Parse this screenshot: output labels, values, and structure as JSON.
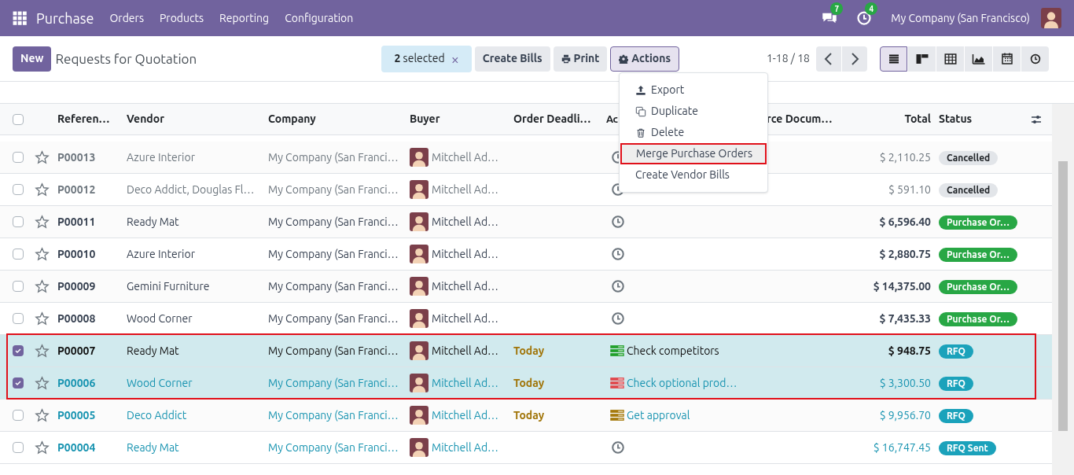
{
  "navbar": {
    "app": "Purchase",
    "menu": [
      "Orders",
      "Products",
      "Reporting",
      "Configuration"
    ],
    "messages_count": "7",
    "activities_count": "4",
    "company": "My Company (San Francisco)"
  },
  "control_panel": {
    "new_button": "New",
    "title": "Requests for Quotation",
    "selection": "**2** selected",
    "clear": "×",
    "buttons": [
      "Create Bills",
      "Print",
      "Actions"
    ],
    "pager": "1-18 / 18",
    "views": [
      {
        "kind": "list",
        "selected": true
      },
      {
        "kind": "kanban",
        "selected": false
      },
      {
        "kind": "pivot",
        "selected": false
      },
      {
        "kind": "graph",
        "selected": false
      },
      {
        "kind": "calendar",
        "selected": false
      },
      {
        "kind": "activity",
        "selected": false
      }
    ]
  },
  "actions_menu": [
    {
      "kind": "export",
      "label": "Export",
      "highlighted": false
    },
    {
      "kind": "duplicate",
      "label": "Duplicate",
      "highlighted": false
    },
    {
      "kind": "delete",
      "label": "Delete",
      "highlighted": false
    },
    {
      "kind": "none",
      "label": "Merge Purchase Orders",
      "highlighted": true
    },
    {
      "kind": "none",
      "label": "Create Vendor Bills",
      "highlighted": false
    }
  ],
  "table": {
    "all_selected": false,
    "columns": [
      "Referen…",
      "Vendor",
      "Company",
      "Buyer",
      "Order Deadli…",
      "Ac",
      "rce Docum…",
      "Total",
      "Status"
    ],
    "rows": [
      {
        "selected": false,
        "kind": "muted",
        "reference": "P00013",
        "vendor": "Azure Interior",
        "company": "My Company (San Franci…",
        "buyer": "Mitchell Ad…",
        "activity": {
          "kind": "clock"
        },
        "total": "$ 2,110.25",
        "status": {
          "kind": "cancelled",
          "label": "Cancelled"
        }
      },
      {
        "selected": false,
        "kind": "muted",
        "reference": "P00012",
        "vendor": "Deco Addict, Douglas Fl…",
        "company": "My Company (San Franci…",
        "buyer": "Mitchell Ad…",
        "activity": {
          "kind": "clock"
        },
        "total": "$ 591.10",
        "status": {
          "kind": "cancelled",
          "label": "Cancelled"
        }
      },
      {
        "selected": false,
        "kind": "normal",
        "reference": "P00011",
        "vendor": "Ready Mat",
        "company": "My Company (San Franci…",
        "buyer": "Mitchell Ad…",
        "activity": {
          "kind": "clock"
        },
        "total": "$ 6,596.40",
        "status": {
          "kind": "purchase",
          "label": "Purchase Or…"
        }
      },
      {
        "selected": false,
        "kind": "normal",
        "reference": "P00010",
        "vendor": "Azure Interior",
        "company": "My Company (San Franci…",
        "buyer": "Mitchell Ad…",
        "activity": {
          "kind": "clock"
        },
        "total": "$ 2,880.75",
        "status": {
          "kind": "purchase",
          "label": "Purchase Or…"
        }
      },
      {
        "selected": false,
        "kind": "normal",
        "reference": "P00009",
        "vendor": "Gemini Furniture",
        "company": "My Company (San Franci…",
        "buyer": "Mitchell Ad…",
        "activity": {
          "kind": "clock"
        },
        "total": "$ 14,375.00",
        "status": {
          "kind": "purchase",
          "label": "Purchase Or…"
        }
      },
      {
        "selected": false,
        "kind": "normal",
        "reference": "P00008",
        "vendor": "Wood Corner",
        "company": "My Company (San Franci…",
        "buyer": "Mitchell Ad…",
        "activity": {
          "kind": "clock"
        },
        "total": "$ 7,435.33",
        "status": {
          "kind": "purchase",
          "label": "Purchase Or…"
        }
      },
      {
        "selected": true,
        "kind": "normal",
        "reference": "P00007",
        "vendor": "Ready Mat",
        "company": "My Company (San Franci…",
        "buyer": "Mitchell Ad…",
        "deadline": "Today",
        "activity": {
          "kind": "task",
          "color": "#21a02b",
          "label": "Check competitors"
        },
        "total": "$ 948.75",
        "status": {
          "kind": "rfq",
          "label": "RFQ"
        }
      },
      {
        "selected": true,
        "kind": "link",
        "reference": "P00006",
        "vendor": "Wood Corner",
        "company": "My Company (San Franci…",
        "buyer": "Mitchell Ad…",
        "deadline": "Today",
        "activity": {
          "kind": "task",
          "color": "#e0474c",
          "label": "Check optional prod…"
        },
        "total": "$ 3,300.50",
        "status": {
          "kind": "rfq",
          "label": "RFQ"
        }
      },
      {
        "selected": false,
        "kind": "link",
        "reference": "P00005",
        "vendor": "Deco Addict",
        "company": "My Company (San Franci…",
        "buyer": "Mitchell Ad…",
        "deadline": "Today",
        "activity": {
          "kind": "task",
          "color": "#a57a0c",
          "label": "Get approval"
        },
        "total": "$ 9,956.70",
        "status": {
          "kind": "rfq",
          "label": "RFQ"
        }
      },
      {
        "selected": false,
        "kind": "link",
        "reference": "P00004",
        "vendor": "Ready Mat",
        "company": "My Company (San Franci…",
        "buyer": "Mitchell Ad…",
        "activity": {
          "kind": "clock"
        },
        "total": "$ 16,747.45",
        "status": {
          "kind": "rfq",
          "label": "RFQ Sent"
        }
      }
    ]
  }
}
